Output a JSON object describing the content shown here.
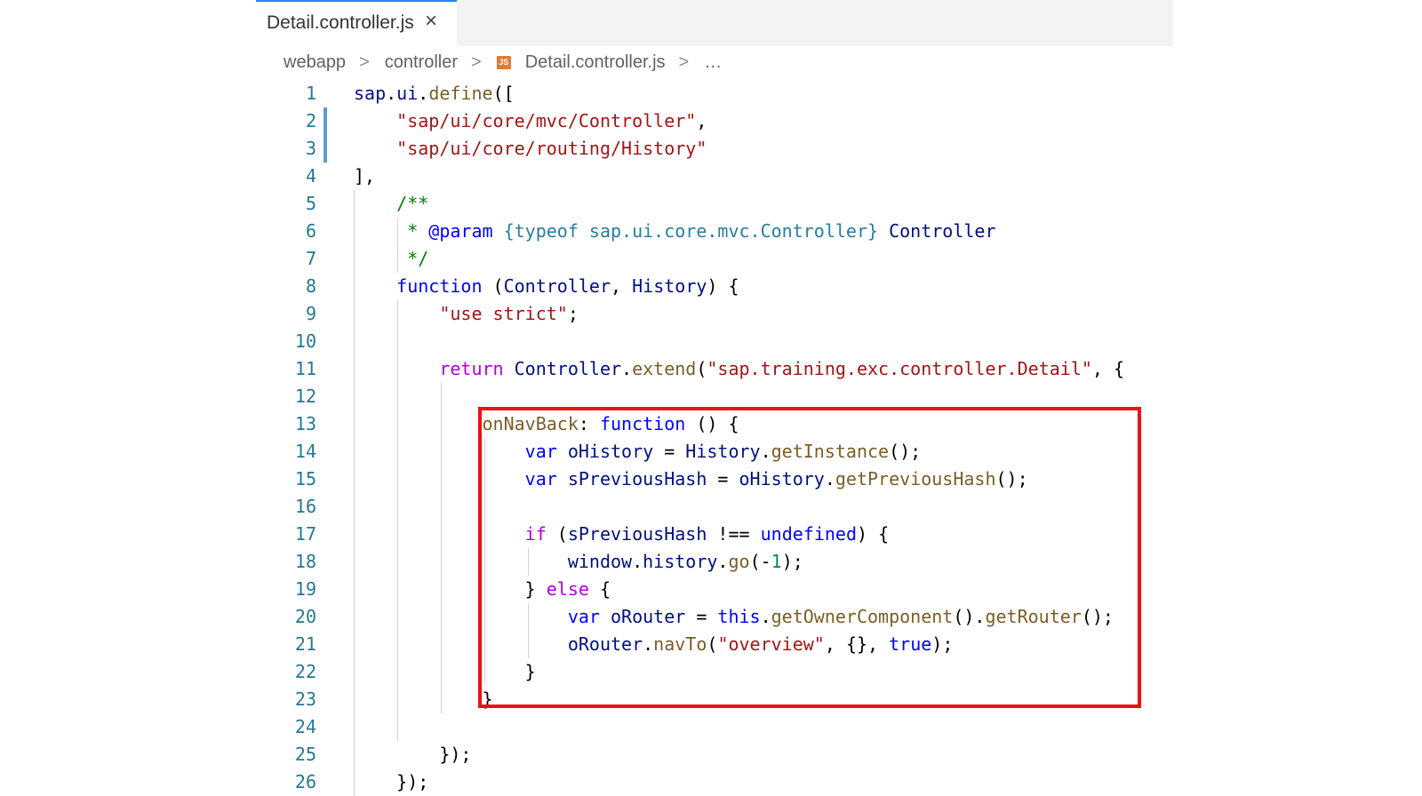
{
  "tab": {
    "title": "Detail.controller.js",
    "close_symbol": "×"
  },
  "breadcrumb": {
    "items": [
      "webapp",
      "controller",
      "Detail.controller.js",
      "…"
    ],
    "file_icon": "js-file-icon"
  },
  "colors": {
    "highlight_border": "#ee1111",
    "modified_gutter": "#5b9bd5",
    "line_numbers": "#237893"
  },
  "code": {
    "highlighted_lines": [
      13,
      23
    ],
    "modified_lines": [
      2,
      3
    ],
    "lines": [
      {
        "n": "1",
        "tokens": [
          [
            "var",
            "sap"
          ],
          [
            "plain",
            "."
          ],
          [
            "var",
            "ui"
          ],
          [
            "plain",
            "."
          ],
          [
            "fn",
            "define"
          ],
          [
            "plain",
            "(["
          ]
        ]
      },
      {
        "n": "2",
        "tokens": [
          [
            "plain",
            "    "
          ],
          [
            "str",
            "\"sap/ui/core/mvc/Controller\""
          ],
          [
            "plain",
            ","
          ]
        ]
      },
      {
        "n": "3",
        "tokens": [
          [
            "plain",
            "    "
          ],
          [
            "str",
            "\"sap/ui/core/routing/History\""
          ]
        ]
      },
      {
        "n": "4",
        "tokens": [
          [
            "plain",
            "],"
          ]
        ]
      },
      {
        "n": "5",
        "tokens": [
          [
            "plain",
            "    "
          ],
          [
            "com",
            "/**"
          ]
        ]
      },
      {
        "n": "6",
        "tokens": [
          [
            "plain",
            "    "
          ],
          [
            "com",
            " * "
          ],
          [
            "doc",
            "@param"
          ],
          [
            "com",
            " "
          ],
          [
            "type",
            "{typeof sap.ui.core.mvc.Controller}"
          ],
          [
            "com",
            " "
          ],
          [
            "var",
            "Controller"
          ]
        ]
      },
      {
        "n": "7",
        "tokens": [
          [
            "plain",
            "    "
          ],
          [
            "com",
            " */"
          ]
        ]
      },
      {
        "n": "8",
        "tokens": [
          [
            "plain",
            "    "
          ],
          [
            "kw",
            "function"
          ],
          [
            "plain",
            " ("
          ],
          [
            "var",
            "Controller"
          ],
          [
            "plain",
            ", "
          ],
          [
            "var",
            "History"
          ],
          [
            "plain",
            ") {"
          ]
        ]
      },
      {
        "n": "9",
        "tokens": [
          [
            "plain",
            "        "
          ],
          [
            "str",
            "\"use strict\""
          ],
          [
            "plain",
            ";"
          ]
        ]
      },
      {
        "n": "10",
        "tokens": []
      },
      {
        "n": "11",
        "tokens": [
          [
            "plain",
            "        "
          ],
          [
            "ctrl",
            "return"
          ],
          [
            "plain",
            " "
          ],
          [
            "var",
            "Controller"
          ],
          [
            "plain",
            "."
          ],
          [
            "fn",
            "extend"
          ],
          [
            "plain",
            "("
          ],
          [
            "str",
            "\"sap.training.exc.controller.Detail\""
          ],
          [
            "plain",
            ", {"
          ]
        ]
      },
      {
        "n": "12",
        "tokens": []
      },
      {
        "n": "13",
        "tokens": [
          [
            "plain",
            "            "
          ],
          [
            "fn",
            "onNavBack"
          ],
          [
            "plain",
            ": "
          ],
          [
            "kw",
            "function"
          ],
          [
            "plain",
            " () {"
          ]
        ]
      },
      {
        "n": "14",
        "tokens": [
          [
            "plain",
            "                "
          ],
          [
            "kw",
            "var"
          ],
          [
            "plain",
            " "
          ],
          [
            "var",
            "oHistory"
          ],
          [
            "plain",
            " = "
          ],
          [
            "var",
            "History"
          ],
          [
            "plain",
            "."
          ],
          [
            "fn",
            "getInstance"
          ],
          [
            "plain",
            "();"
          ]
        ]
      },
      {
        "n": "15",
        "tokens": [
          [
            "plain",
            "                "
          ],
          [
            "kw",
            "var"
          ],
          [
            "plain",
            " "
          ],
          [
            "var",
            "sPreviousHash"
          ],
          [
            "plain",
            " = "
          ],
          [
            "var",
            "oHistory"
          ],
          [
            "plain",
            "."
          ],
          [
            "fn",
            "getPreviousHash"
          ],
          [
            "plain",
            "();"
          ]
        ]
      },
      {
        "n": "16",
        "tokens": []
      },
      {
        "n": "17",
        "tokens": [
          [
            "plain",
            "                "
          ],
          [
            "ctrl",
            "if"
          ],
          [
            "plain",
            " ("
          ],
          [
            "var",
            "sPreviousHash"
          ],
          [
            "plain",
            " !== "
          ],
          [
            "kw",
            "undefined"
          ],
          [
            "plain",
            ") {"
          ]
        ]
      },
      {
        "n": "18",
        "tokens": [
          [
            "plain",
            "                    "
          ],
          [
            "var",
            "window"
          ],
          [
            "plain",
            "."
          ],
          [
            "var",
            "history"
          ],
          [
            "plain",
            "."
          ],
          [
            "fn",
            "go"
          ],
          [
            "plain",
            "(-"
          ],
          [
            "num",
            "1"
          ],
          [
            "plain",
            ");"
          ]
        ]
      },
      {
        "n": "19",
        "tokens": [
          [
            "plain",
            "                } "
          ],
          [
            "ctrl",
            "else"
          ],
          [
            "plain",
            " {"
          ]
        ]
      },
      {
        "n": "20",
        "tokens": [
          [
            "plain",
            "                    "
          ],
          [
            "kw",
            "var"
          ],
          [
            "plain",
            " "
          ],
          [
            "var",
            "oRouter"
          ],
          [
            "plain",
            " = "
          ],
          [
            "kw",
            "this"
          ],
          [
            "plain",
            "."
          ],
          [
            "fn",
            "getOwnerComponent"
          ],
          [
            "plain",
            "()."
          ],
          [
            "fn",
            "getRouter"
          ],
          [
            "plain",
            "();"
          ]
        ]
      },
      {
        "n": "21",
        "tokens": [
          [
            "plain",
            "                    "
          ],
          [
            "var",
            "oRouter"
          ],
          [
            "plain",
            "."
          ],
          [
            "fn",
            "navTo"
          ],
          [
            "plain",
            "("
          ],
          [
            "str",
            "\"overview\""
          ],
          [
            "plain",
            ", {}, "
          ],
          [
            "kw",
            "true"
          ],
          [
            "plain",
            ");"
          ]
        ]
      },
      {
        "n": "22",
        "tokens": [
          [
            "plain",
            "                }"
          ]
        ]
      },
      {
        "n": "23",
        "tokens": [
          [
            "plain",
            "            }"
          ]
        ]
      },
      {
        "n": "24",
        "tokens": []
      },
      {
        "n": "25",
        "tokens": [
          [
            "plain",
            "        });"
          ]
        ]
      },
      {
        "n": "26",
        "tokens": [
          [
            "plain",
            "    });"
          ]
        ]
      }
    ]
  }
}
